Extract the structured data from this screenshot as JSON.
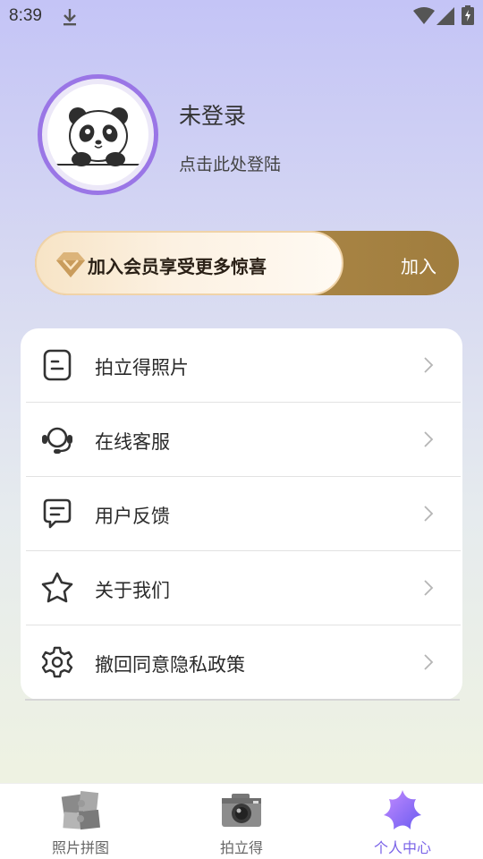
{
  "status_bar": {
    "time": "8:39"
  },
  "profile": {
    "username": "未登录",
    "login_hint": "点击此处登陆"
  },
  "vip_banner": {
    "text": "加入会员享受更多惊喜",
    "join_label": "加入"
  },
  "menu": {
    "items": [
      {
        "label": "拍立得照片",
        "icon": "photo-note-icon"
      },
      {
        "label": "在线客服",
        "icon": "headset-icon"
      },
      {
        "label": "用户反馈",
        "icon": "feedback-icon"
      },
      {
        "label": "关于我们",
        "icon": "star-icon"
      },
      {
        "label": "撤回同意隐私政策",
        "icon": "gear-icon"
      }
    ]
  },
  "bottom_nav": {
    "items": [
      {
        "label": "照片拼图",
        "icon": "puzzle-icon"
      },
      {
        "label": "拍立得",
        "icon": "camera-icon"
      },
      {
        "label": "个人中心",
        "icon": "user-star-icon",
        "active": true
      }
    ]
  },
  "colors": {
    "accent": "#7a63e8",
    "avatar_ring": "#9a76e6",
    "vip_gold": "#a98545"
  }
}
